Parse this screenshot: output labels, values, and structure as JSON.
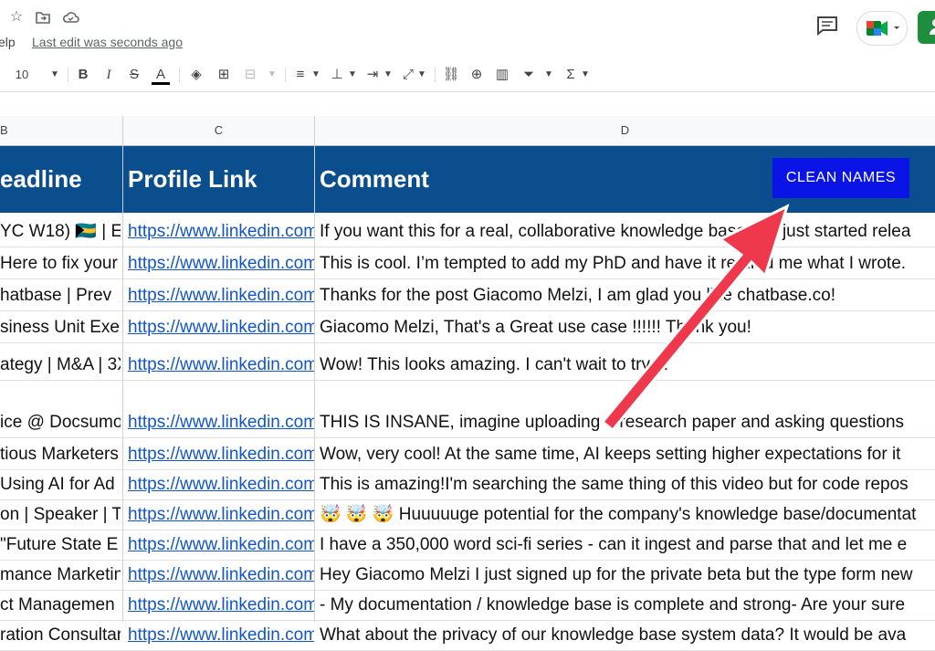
{
  "menu": {
    "help_partial": "elp"
  },
  "status": {
    "last_edit": "Last edit was seconds ago"
  },
  "toolbar": {
    "font_size": "10"
  },
  "icons": {
    "star": "star-icon",
    "move": "move-to-folder-icon",
    "cloud": "cloud-saved-icon",
    "comment": "comment-icon",
    "meet": "google-meet-icon",
    "share": "share-icon"
  },
  "columns": {
    "b": "B",
    "c": "C",
    "d": "D"
  },
  "header": {
    "headline": "eadline",
    "profile_link": "Profile Link",
    "comment": "Comment",
    "clean_button": "CLEAN NAMES"
  },
  "rows": [
    {
      "b": "YC W18) 🇧🇸 | E",
      "c": "https://www.linkedin.com",
      "d": "If you want this for a real, collaborative knowledge base, we just started relea",
      "h": 34
    },
    {
      "b": "Here to fix your",
      "c": "https://www.linkedin.com",
      "d": "This is cool. I’m tempted to add my PhD and have it remind me what I wrote.",
      "h": 34
    },
    {
      "b": "hatbase | Prev",
      "c": "https://www.linkedin.com",
      "d": "Thanks for the post Giacomo Melzi, I am glad you like chatbase.co!",
      "h": 34
    },
    {
      "b": "siness Unit Exe",
      "c": "https://www.linkedin.com",
      "d": "Giacomo Melzi, That's a Great use case !!!!!! Thank you!",
      "h": 34
    },
    {
      "b": "ategy | M&A | 3X",
      "c": "https://www.linkedin.com",
      "d": "Wow! This looks amazing. I can't wait to try it!",
      "h": 40
    },
    {
      "b": "ice @ Docsumo",
      "c": "https://www.linkedin.com",
      "d": "THIS IS INSANE, imagine uploading a research paper and asking questions",
      "h": 62
    },
    {
      "b": "tious Marketers",
      "c": "https://www.linkedin.com",
      "d": "Wow, very cool! At the same time, AI keeps setting higher expectations for it",
      "h": 34
    },
    {
      "b": "Using AI for Ad",
      "c": "https://www.linkedin.com",
      "d": "This is amazing!I'm searching the same thing of this video but for code repos",
      "h": 32
    },
    {
      "b": "on | Speaker | T",
      "c": "https://www.linkedin.com",
      "d": "🤯 🤯 🤯 Huuuuuge potential for the company's knowledge base/documentat",
      "h": 32
    },
    {
      "b": " \"Future State E",
      "c": "https://www.linkedin.com",
      "d": "I have a 350,000 word sci-fi series - can it ingest and parse that and let me e",
      "h": 32
    },
    {
      "b": "mance Marketin",
      "c": "https://www.linkedin.com",
      "d": "Hey Giacomo Melzi I just signed up for the private beta but the type form new",
      "h": 32
    },
    {
      "b": "ct Managemen",
      "c": "https://www.linkedin.com",
      "d": "- My documentation / knowledge base is complete and strong- Are your sure",
      "h": 32
    },
    {
      "b": "ration Consultar",
      "c": "https://www.linkedin.com",
      "d": "What about the privacy of our knowledge base system data? It would be ava",
      "h": 32
    }
  ]
}
